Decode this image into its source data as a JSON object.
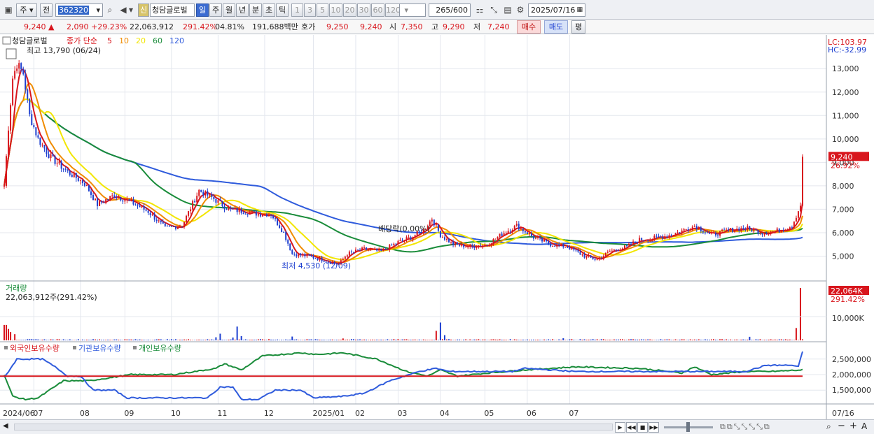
{
  "toolbar": {
    "type_select": "주",
    "prev_label": "전",
    "code": "362320",
    "new_badge": "신",
    "stock_name": "청담글로벌",
    "periods": [
      "일",
      "주",
      "월",
      "년",
      "분",
      "초",
      "틱"
    ],
    "active_period": "일",
    "intervals": [
      "1",
      "3",
      "5",
      "10",
      "20",
      "30",
      "60",
      "120"
    ],
    "count": "265",
    "count_max": "/600",
    "date": "2025/07/16"
  },
  "quote": {
    "price": "9,240",
    "change": "2,090",
    "change_pct": "+29.23%",
    "volume": "22,063,912",
    "volume_ratio": "291.42%",
    "turnover_pct": "04.81%",
    "amount": "191,688백만",
    "bid_label": "호가",
    "bid1": "9,250",
    "bid2": "9,240",
    "open_label": "시",
    "open": "7,350",
    "high_label": "고",
    "high": "9,290",
    "low_label": "저",
    "low": "7,240",
    "buy_label": "매수",
    "sell_label": "매도",
    "eval_label": "평"
  },
  "chart_data": {
    "type": "candlestick",
    "title": "청담글로벌",
    "legend": {
      "price_label": "종가 단순",
      "ma_periods": [
        "5",
        "10",
        "20",
        "60",
        "120"
      ],
      "ma_colors": [
        "#d8161d",
        "#f08c00",
        "#f2e600",
        "#1a8c3a",
        "#2f5bdc"
      ]
    },
    "y_ticks": [
      "13,000",
      "12,000",
      "11,000",
      "10,000",
      "9,000",
      "8,000",
      "7,000",
      "6,000",
      "5,000"
    ],
    "y_range": [
      4000,
      14200
    ],
    "lc": "LC:103.97",
    "hc": "HC:-32.99",
    "last_price_tag": "9,240",
    "last_pct_tag": "26.92%",
    "high_annotation": "최고 13,790 (06/24)",
    "low_annotation": "최저 4,530 (12/09)",
    "dividend_annotation": "배당락(0.00%)",
    "x_labels": [
      "2024/06",
      "07",
      "08",
      "09",
      "10",
      "11",
      "12",
      "2025/01",
      "02",
      "03",
      "04",
      "05",
      "06",
      "07"
    ],
    "x_end_label": "07/16",
    "price_anchors": [
      [
        0,
        8000
      ],
      [
        2,
        10500
      ],
      [
        4,
        12600
      ],
      [
        6,
        13200
      ],
      [
        9,
        12800
      ],
      [
        12,
        11000
      ],
      [
        16,
        10000
      ],
      [
        22,
        9200
      ],
      [
        30,
        8600
      ],
      [
        38,
        8100
      ],
      [
        44,
        7200
      ],
      [
        52,
        7600
      ],
      [
        60,
        7300
      ],
      [
        68,
        6900
      ],
      [
        76,
        6200
      ],
      [
        84,
        6300
      ],
      [
        92,
        7800
      ],
      [
        98,
        7500
      ],
      [
        106,
        7000
      ],
      [
        114,
        6900
      ],
      [
        120,
        6800
      ],
      [
        126,
        6800
      ],
      [
        132,
        6000
      ],
      [
        136,
        5100
      ],
      [
        144,
        5000
      ],
      [
        152,
        4800
      ],
      [
        158,
        4650
      ],
      [
        162,
        5100
      ],
      [
        170,
        5300
      ],
      [
        178,
        5200
      ],
      [
        186,
        5600
      ],
      [
        192,
        5800
      ],
      [
        198,
        6100
      ],
      [
        202,
        6600
      ],
      [
        206,
        5900
      ],
      [
        212,
        5500
      ],
      [
        220,
        5400
      ],
      [
        228,
        5500
      ],
      [
        236,
        6000
      ],
      [
        242,
        6300
      ],
      [
        250,
        5800
      ],
      [
        258,
        5500
      ],
      [
        266,
        5400
      ],
      [
        274,
        5000
      ],
      [
        280,
        4850
      ],
      [
        286,
        5200
      ],
      [
        294,
        5400
      ],
      [
        300,
        5700
      ],
      [
        310,
        5800
      ],
      [
        318,
        6000
      ],
      [
        326,
        6300
      ],
      [
        334,
        5900
      ],
      [
        342,
        6100
      ],
      [
        350,
        6200
      ],
      [
        358,
        6000
      ],
      [
        366,
        6100
      ],
      [
        372,
        6300
      ],
      [
        376,
        7150
      ],
      [
        377,
        9240
      ]
    ],
    "volume_title": "거래량",
    "volume_value": "22,063,912주(291.42%)",
    "volume_tag": "22,064K",
    "volume_tag_pct": "291.42%",
    "volume_tick": "10,000K",
    "volume_max_k": 22064,
    "volume_spikes": [
      [
        0,
        6500
      ],
      [
        1,
        6500
      ],
      [
        2,
        4800
      ],
      [
        3,
        3500
      ],
      [
        5,
        2600
      ],
      [
        100,
        1300
      ],
      [
        102,
        2800
      ],
      [
        108,
        1200
      ],
      [
        110,
        5800
      ],
      [
        112,
        1800
      ],
      [
        136,
        1600
      ],
      [
        160,
        800
      ],
      [
        204,
        4000
      ],
      [
        206,
        7500
      ],
      [
        208,
        2200
      ],
      [
        264,
        900
      ],
      [
        352,
        1500
      ],
      [
        374,
        5200
      ],
      [
        376,
        22064
      ]
    ],
    "holdings_title": "외국인보유수량",
    "holdings_series": [
      "외국인보유수량",
      "기관보유수량",
      "개인보유수량"
    ],
    "holdings_colors": [
      "#d8161d",
      "#2f5bdc",
      "#1a8c3a"
    ],
    "holdings_ticks": [
      "2,500,000",
      "2,000,000",
      "1,500,000"
    ],
    "holdings_range": [
      1100000,
      2900000
    ],
    "foreign_level": 1950000
  },
  "bottom": {
    "controls": [
      "▶",
      "⏮",
      "■",
      "⏭"
    ]
  }
}
